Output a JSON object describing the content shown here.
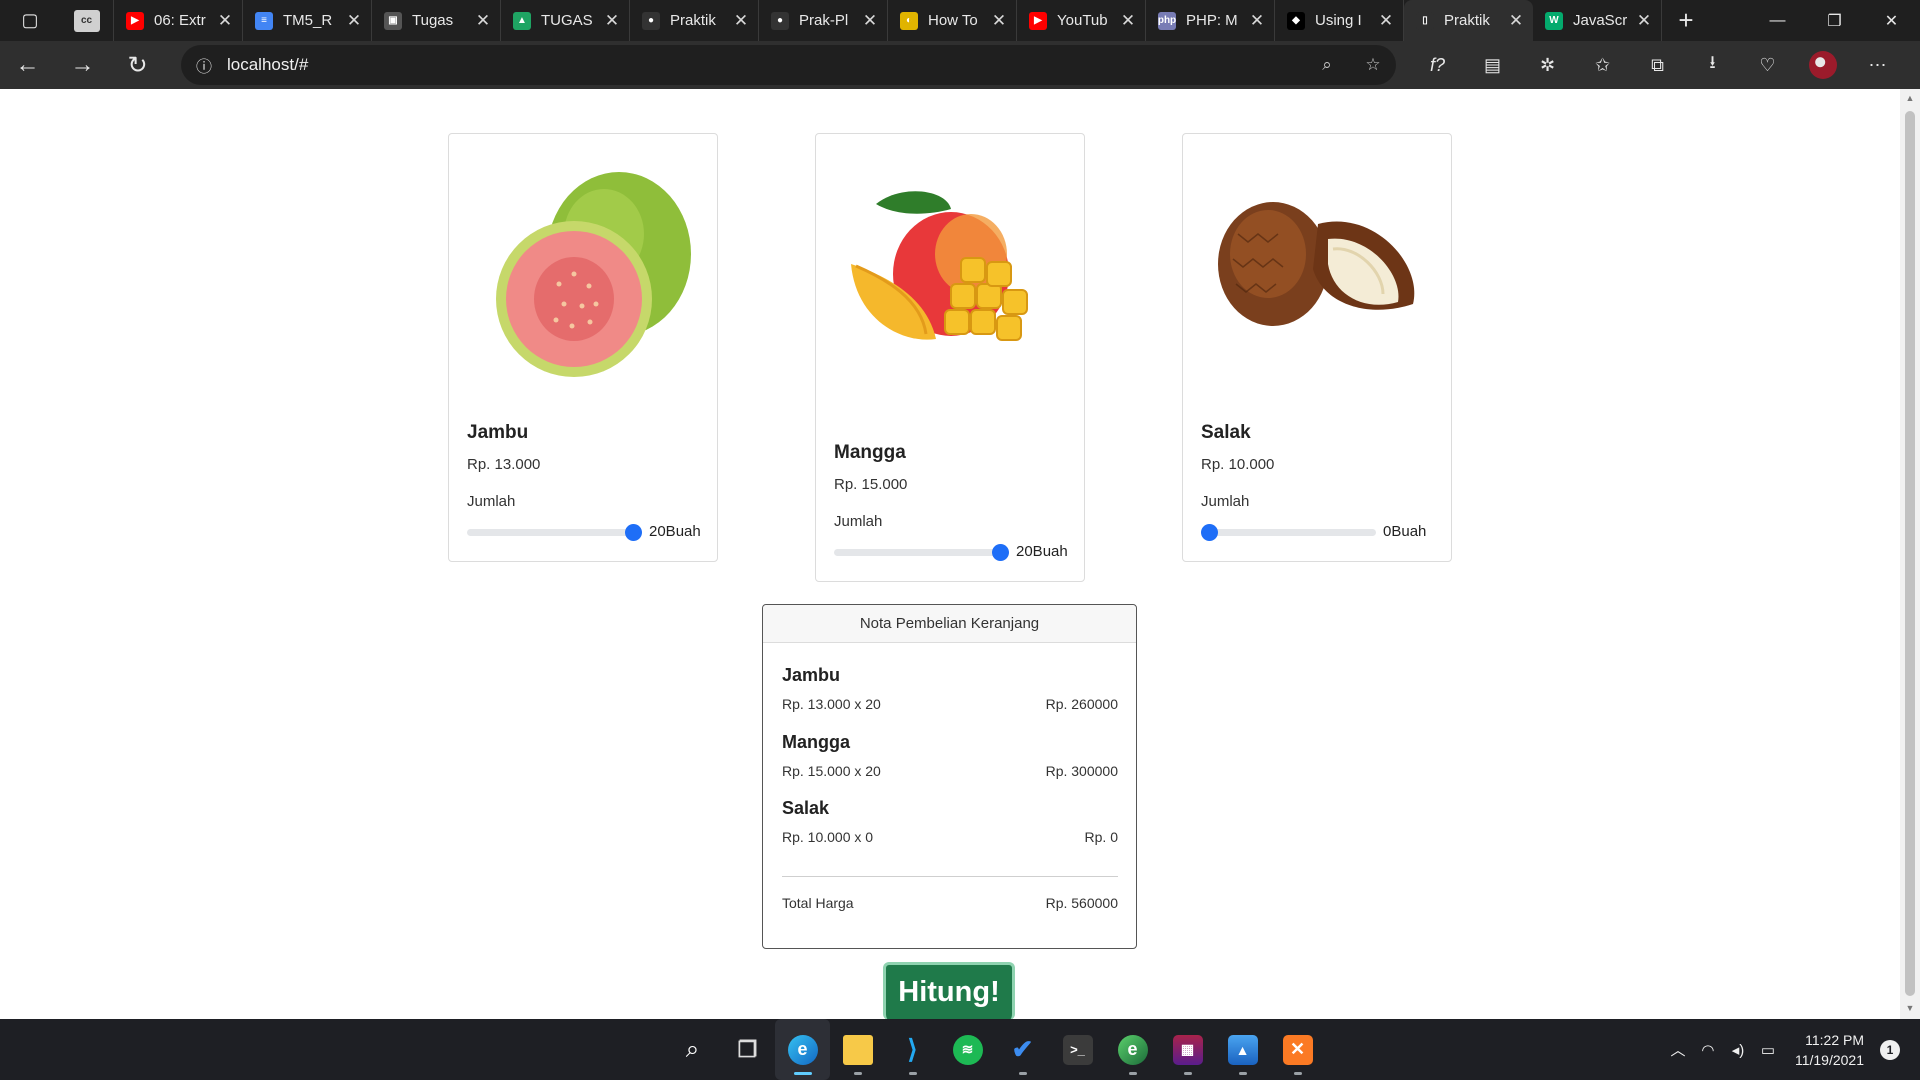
{
  "browser": {
    "tabs": [
      {
        "title": "",
        "icon": "cc-icon",
        "color": "#5a5a5a",
        "glyph": "cc"
      },
      {
        "title": "06: Extr",
        "icon": "youtube-icon",
        "color": "#ff0000",
        "glyph": "▶"
      },
      {
        "title": "TM5_R",
        "icon": "docs-icon",
        "color": "#4285f4",
        "glyph": "≡"
      },
      {
        "title": "Tugas",
        "icon": "classroom-icon",
        "color": "#555555",
        "glyph": "▣"
      },
      {
        "title": "TUGAS",
        "icon": "drive-icon",
        "color": "#1fa463",
        "glyph": "▲"
      },
      {
        "title": "Praktik",
        "icon": "github-icon",
        "color": "#333333",
        "glyph": "●"
      },
      {
        "title": "Prak-Pl",
        "icon": "github-icon",
        "color": "#333333",
        "glyph": "●"
      },
      {
        "title": "How To",
        "icon": "site-icon",
        "color": "#e0b400",
        "glyph": "◐"
      },
      {
        "title": "YouTub",
        "icon": "youtube-icon",
        "color": "#ff0000",
        "glyph": "▶"
      },
      {
        "title": "PHP: M",
        "icon": "php-icon",
        "color": "#787cb5",
        "glyph": "php"
      },
      {
        "title": "Using I",
        "icon": "site-icon",
        "color": "#000000",
        "glyph": "◆"
      },
      {
        "title": "Praktik",
        "icon": "page-icon",
        "color": "#2f2f2f",
        "glyph": "▯",
        "active": true
      },
      {
        "title": "JavaScr",
        "icon": "w3schools-icon",
        "color": "#04aa6d",
        "glyph": "W"
      }
    ],
    "address": "localhost/#"
  },
  "products": [
    {
      "name": "Jambu",
      "price": "Rp. 13.000",
      "qty_label": "Jumlah",
      "qty_text": "20Buah",
      "qty_fraction": 1.0
    },
    {
      "name": "Mangga",
      "price": "Rp. 15.000",
      "qty_label": "Jumlah",
      "qty_text": "20Buah",
      "qty_fraction": 1.0
    },
    {
      "name": "Salak",
      "price": "Rp. 10.000",
      "qty_label": "Jumlah",
      "qty_text": "0Buah",
      "qty_fraction": 0.0
    }
  ],
  "nota": {
    "header": "Nota Pembelian Keranjang",
    "items": [
      {
        "name": "Jambu",
        "calc": "Rp. 13.000 x 20",
        "subtotal": "Rp. 260000"
      },
      {
        "name": "Mangga",
        "calc": "Rp. 15.000 x 20",
        "subtotal": "Rp. 300000"
      },
      {
        "name": "Salak",
        "calc": "Rp. 10.000 x 0",
        "subtotal": "Rp. 0"
      }
    ],
    "total_label": "Total Harga",
    "total_value": "Rp. 560000"
  },
  "hitung_label": "Hitung!",
  "taskbar": {
    "time": "11:22 PM",
    "date": "11/19/2021",
    "notifications": "1"
  },
  "colors": {
    "accent": "#1e6ef7",
    "hitung": "#1f7a4a"
  }
}
